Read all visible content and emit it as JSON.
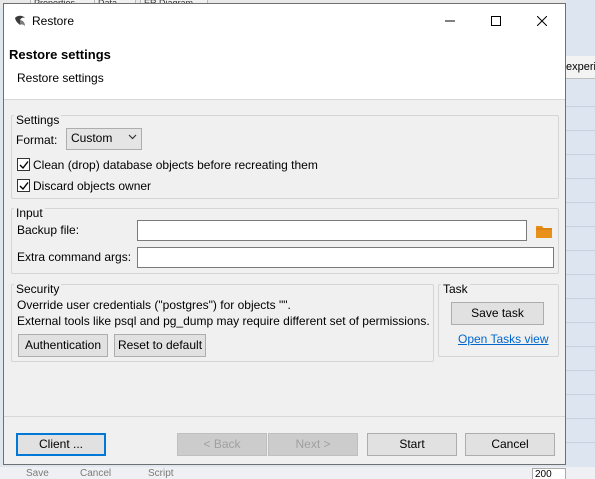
{
  "background": {
    "tabs": [
      "Properties",
      "Data",
      "ER Diagram"
    ],
    "right_header": "experi",
    "bottom_toolbar": {
      "save": "Save",
      "cancel": "Cancel",
      "script": "Script",
      "count": "200"
    }
  },
  "window": {
    "title": "Restore",
    "minimize_icon": "minimize-icon",
    "maximize_icon": "maximize-icon",
    "close_icon": "close-icon"
  },
  "header": {
    "title": "Restore settings",
    "description": "Restore settings"
  },
  "settings": {
    "group_title": "Settings",
    "format_label": "Format:",
    "format_value": "Custom",
    "clean_label": "Clean (drop) database objects before recreating them",
    "clean_checked": true,
    "discard_label": "Discard objects owner",
    "discard_checked": true
  },
  "input": {
    "group_title": "Input",
    "backup_file_label": "Backup file:",
    "backup_file_value": "",
    "extra_args_label": "Extra command args:",
    "extra_args_value": ""
  },
  "security": {
    "group_title": "Security",
    "line1": "Override user credentials (\"postgres\") for objects \"\".",
    "line2": "External tools like psql and pg_dump may require different set of permissions.",
    "auth_button": "Authentication",
    "reset_button": "Reset to default"
  },
  "task": {
    "group_title": "Task",
    "save_button": "Save task",
    "open_link": "Open Tasks view"
  },
  "footer": {
    "client_button": "Client ...",
    "back_button": "< Back",
    "next_button": "Next >",
    "start_button": "Start",
    "cancel_button": "Cancel"
  },
  "colors": {
    "accent": "#0078d7",
    "folder": "#e8901a",
    "link": "#0066cc"
  }
}
